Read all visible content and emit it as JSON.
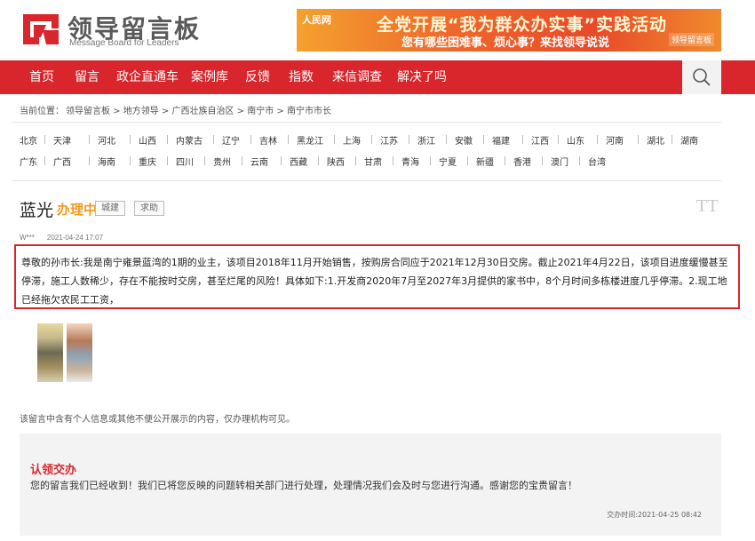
{
  "header": {
    "logo_title": "领导留言板",
    "logo_subtitle": "Message Board for Leaders",
    "banner_logo": "人民网",
    "banner_line1": "全党开展“我为群众办实事”实践活动",
    "banner_line2": "您有哪些困难事、烦心事？来找领导说说",
    "banner_mark": "领导留言板"
  },
  "nav": {
    "items": [
      "首页",
      "留言",
      "政企直通车",
      "案例库",
      "反馈",
      "指数",
      "来信调查",
      "解决了吗"
    ],
    "search_icon": "search-icon"
  },
  "breadcrumb": {
    "prefix": "当前位置：",
    "path": "领导留言板 > 地方领导 > 广西壮族自治区 > 南宁市 > 南宁市市长"
  },
  "regions": {
    "row1": [
      "北京",
      "天津",
      "河北",
      "山西",
      "内蒙古",
      "辽宁",
      "吉林",
      "黑龙江",
      "上海",
      "江苏",
      "浙江",
      "安徽",
      "福建",
      "江西",
      "山东",
      "河南",
      "湖北",
      "湖南"
    ],
    "row2": [
      "广东",
      "广西",
      "海南",
      "重庆",
      "四川",
      "贵州",
      "云南",
      "西藏",
      "陕西",
      "甘肃",
      "青海",
      "宁夏",
      "新疆",
      "香港",
      "澳门",
      "台湾"
    ]
  },
  "message": {
    "title": "蓝光",
    "status": "办理中",
    "tags": [
      "城建",
      "求助"
    ],
    "font_toggle": "TT",
    "author": "W***",
    "date": "2021-04-24 17:07",
    "body": "尊敬的孙市长:我是南宁雍景蓝湾的1期的业主，该项目2018年11月开始销售，按购房合同应于2021年12月30日交房。截止2021年4月22日，该项目进度缓慢甚至停滞，施工人数稀少，存在不能按时交房，甚至烂尾的风险！具体如下:1.开发商2020年7月至2027年3月提供的家书中，8个月时间多栋楼进度几乎停滞。2.现工地已经拖欠农民工工资，",
    "privacy_note": "该留言中含有个人信息或其他不便公开展示的内容，仅办理机构可见。"
  },
  "reply": {
    "title": "认领交办",
    "text": "您的留言我们已经收到！我们已将您反映的问题转相关部门进行处理，处理情况我们会及时与您进行沟通。感谢您的宝贵留言！",
    "time_label": "交办时间:",
    "time_value": "2021-04-25 08:42"
  },
  "colors": {
    "brand_red": "#d9262d",
    "status_orange": "#f29a23"
  }
}
